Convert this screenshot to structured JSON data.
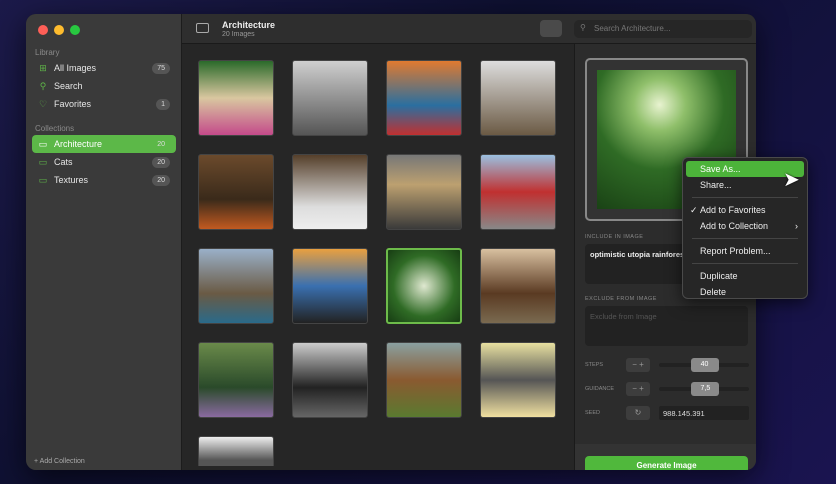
{
  "sidebar": {
    "library_label": "Library",
    "collections_label": "Collections",
    "library": [
      {
        "label": "All Images",
        "count": "75",
        "icon": "grid-icon"
      },
      {
        "label": "Search",
        "icon": "search-icon"
      },
      {
        "label": "Favorites",
        "count": "1",
        "icon": "heart-icon"
      }
    ],
    "collections": [
      {
        "label": "Architecture",
        "count": "20"
      },
      {
        "label": "Cats",
        "count": "20"
      },
      {
        "label": "Textures",
        "count": "20"
      }
    ],
    "add_collection": "Add Collection"
  },
  "toolbar": {
    "title": "Architecture",
    "subtitle": "20 Images",
    "search_placeholder": "Search Architecture..."
  },
  "detail": {
    "include_label": "INCLUDE IN IMAGE",
    "include_value": "optimistic utopia rainforest",
    "exclude_label": "EXCLUDE FROM IMAGE",
    "exclude_placeholder": "Exclude from Image",
    "steps_label": "STEPS",
    "steps_value": "40",
    "steps_fraction": 0.35,
    "guidance_label": "GUIDANCE",
    "guidance_value": "7,5",
    "guidance_fraction": 0.36,
    "seed_label": "SEED",
    "seed_value": "988.145.391",
    "generate_label": "Generate Image"
  },
  "context_menu": [
    "Save As...",
    "Share...",
    "Add to Favorites",
    "Add to Collection",
    "Report Problem...",
    "Duplicate",
    "Delete"
  ],
  "colors": {
    "accent": "#5cb848"
  }
}
